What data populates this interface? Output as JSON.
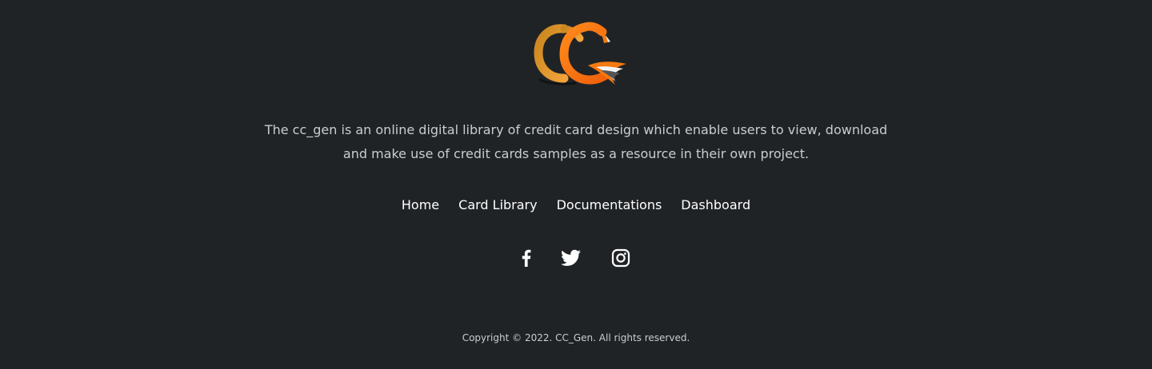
{
  "brand": {
    "logo_icon": "cc-gen-logo-icon",
    "colors": {
      "orange": "#f57a12",
      "gold": "#e09a2e",
      "background": "#202326"
    }
  },
  "description": {
    "line1": "The cc_gen is an online digital library of credit card design which enable users to view, download",
    "line2": "and make use of credit cards samples as a resource in their own project."
  },
  "nav": {
    "items": [
      {
        "label": "Home"
      },
      {
        "label": "Card Library"
      },
      {
        "label": "Documentations"
      },
      {
        "label": "Dashboard"
      }
    ]
  },
  "social": {
    "icons": [
      "facebook-icon",
      "twitter-icon",
      "instagram-icon"
    ]
  },
  "copyright": "Copyright © 2022. CC_Gen. All rights reserved."
}
